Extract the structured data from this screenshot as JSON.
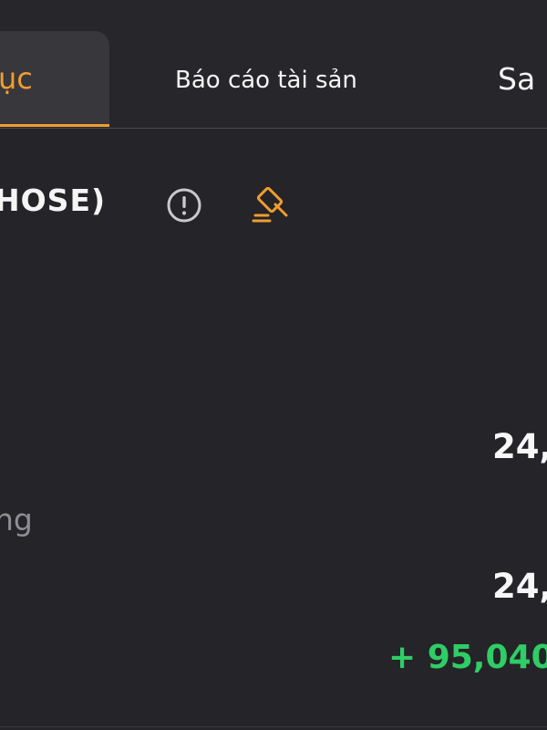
{
  "tabs": {
    "active_label": "ục",
    "assets_label": "Báo cáo tài sản",
    "next_label": "Sa"
  },
  "stock": {
    "title": "HOSE)"
  },
  "rows": {
    "value_1": "24,",
    "label_partial": "ng",
    "value_2": "24,",
    "change": "+ 95,040"
  },
  "icons": {
    "info": "info-circle-icon",
    "gavel": "gavel-icon"
  },
  "colors": {
    "accent": "#ef9d31",
    "positive": "#2fcd66",
    "muted_text": "#8f8e94",
    "background": "#252428"
  }
}
